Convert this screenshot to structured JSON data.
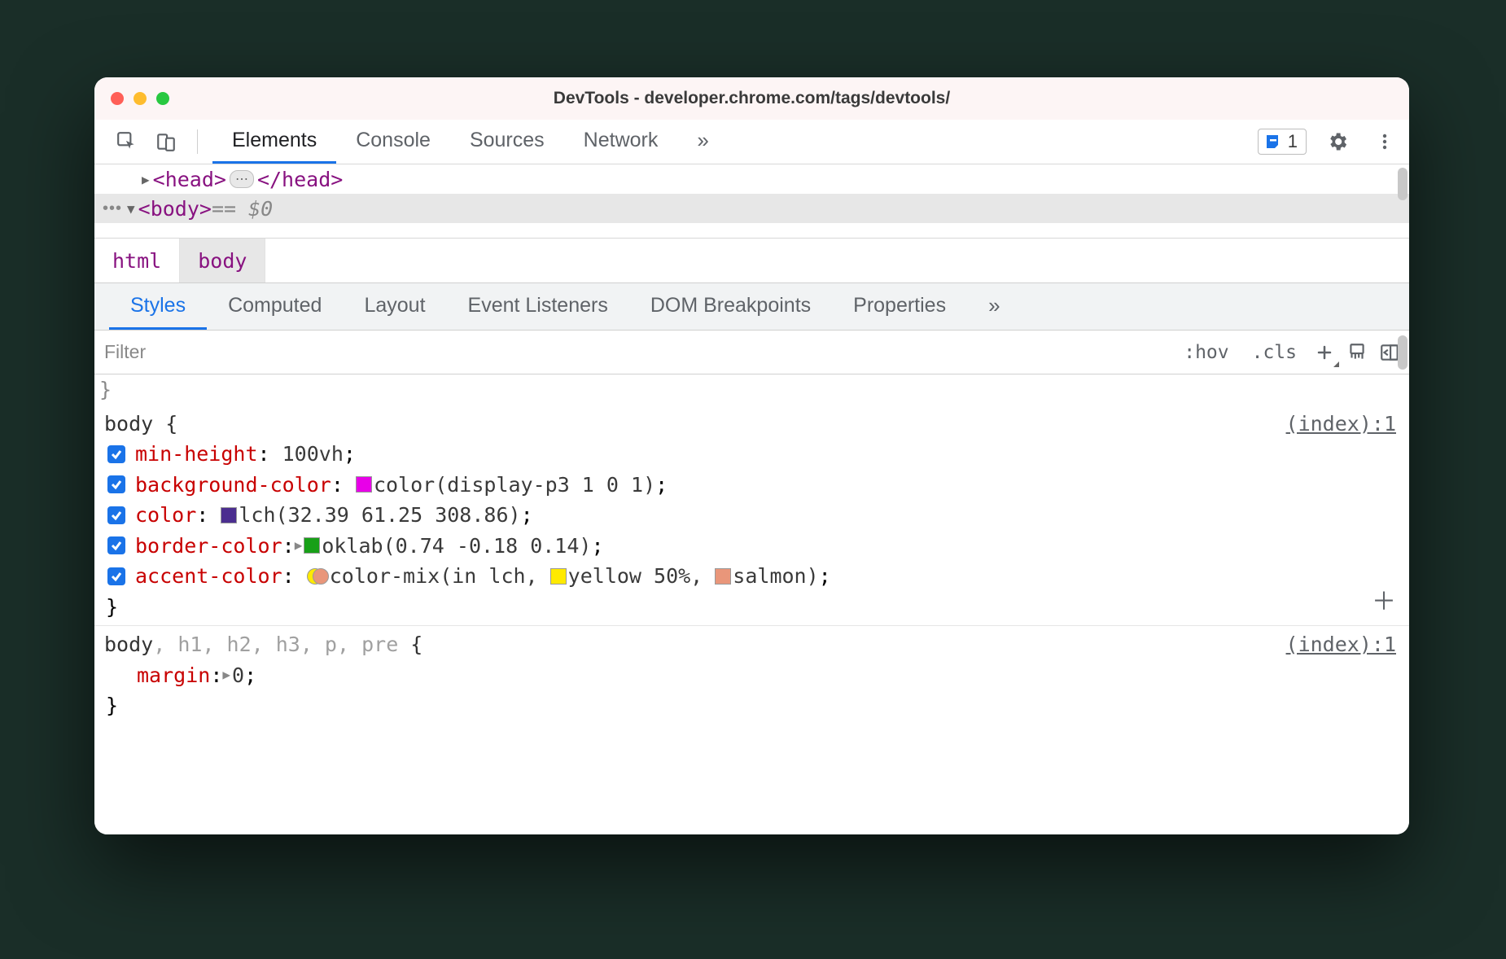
{
  "window_title": "DevTools - developer.chrome.com/tags/devtools/",
  "toolbar": {
    "tabs": [
      "Elements",
      "Console",
      "Sources",
      "Network"
    ],
    "active_index": 0,
    "overflow_glyph": "»",
    "issues_count": "1"
  },
  "dom": {
    "head_open": "<head>",
    "head_close": "</head>",
    "body_open": "<body>",
    "eq0": "== $0"
  },
  "breadcrumb": [
    "html",
    "body"
  ],
  "breadcrumb_selected": 1,
  "subtabs": [
    "Styles",
    "Computed",
    "Layout",
    "Event Listeners",
    "DOM Breakpoints",
    "Properties"
  ],
  "subtabs_active": 0,
  "subtabs_overflow": "»",
  "filter": {
    "placeholder": "Filter",
    "hov": ":hov",
    "cls": ".cls"
  },
  "rules": [
    {
      "selector_plain": "body",
      "selector_faded": "",
      "open": " {",
      "source": "(index):1",
      "decls": [
        {
          "prop": "min-height",
          "pre": "",
          "swatches": [],
          "value": "100vh",
          "expand": false
        },
        {
          "prop": "background-color",
          "pre": "",
          "swatches": [
            "#e800e8"
          ],
          "value": "color(display-p3 1 0 1)",
          "expand": false
        },
        {
          "prop": "color",
          "pre": "",
          "swatches": [
            "#4b2e8f"
          ],
          "value": "lch(32.39 61.25 308.86)",
          "expand": false
        },
        {
          "prop": "border-color",
          "pre": "",
          "swatches": [
            "#18a018"
          ],
          "value": "oklab(0.74 -0.18 0.14)",
          "expand": true
        },
        {
          "prop": "accent-color",
          "pre": "mix",
          "swatches": [],
          "value_parts": [
            "color-mix(in lch, ",
            {
              "swatch": "#ffea00"
            },
            "yellow 50%, ",
            {
              "swatch": "#e9967a"
            },
            "salmon)"
          ],
          "expand": false
        }
      ],
      "close": "}"
    },
    {
      "selector_plain": "body",
      "selector_faded": ", h1, h2, h3, p, pre",
      "open": " {",
      "source": "(index):1",
      "decls": [
        {
          "prop": "margin",
          "pre": "",
          "swatches": [],
          "value": "0",
          "expand": true,
          "no_check": true
        }
      ],
      "close": "}"
    }
  ],
  "colors": {
    "magenta": "#e800e8",
    "purple": "#4b2e8f",
    "green": "#18a018",
    "yellow": "#ffea00",
    "salmon": "#e9967a"
  }
}
